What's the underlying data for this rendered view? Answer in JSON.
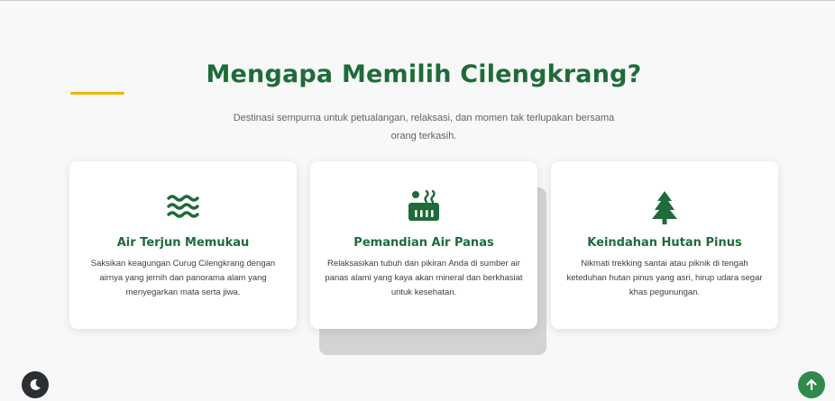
{
  "section": {
    "title": "Mengapa Memilih Cilengkrang?",
    "subtitle": "Destinasi sempurna untuk petualangan, relaksasi, dan momen tak terlupakan bersama orang terkasih."
  },
  "features": [
    {
      "icon": "water-waves-icon",
      "title": "Air Terjun Memukau",
      "description": "Saksikan keagungan Curug Cilengkrang dengan airnya yang jernih dan panorama alam yang menyegarkan mata serta jiwa."
    },
    {
      "icon": "hot-tub-icon",
      "title": "Pemandian Air Panas",
      "description": "Relaksasikan tubuh dan pikiran Anda di sumber air panas alami yang kaya akan mineral dan berkhasiat untuk kesehatan."
    },
    {
      "icon": "pine-tree-icon",
      "title": "Keindahan Hutan Pinus",
      "description": "Nikmati trekking santai atau piknik di tengah keteduhan hutan pinus yang asri, hirup udara segar khas pegunungan."
    }
  ],
  "controls": {
    "theme_toggle_icon": "moon-icon",
    "back_to_top_icon": "arrow-up-icon"
  },
  "colors": {
    "brand_green": "#1f6b3a",
    "accent_yellow": "#f0b400",
    "button_green": "#2f8a4c",
    "toggle_dark": "#2b2f33"
  }
}
